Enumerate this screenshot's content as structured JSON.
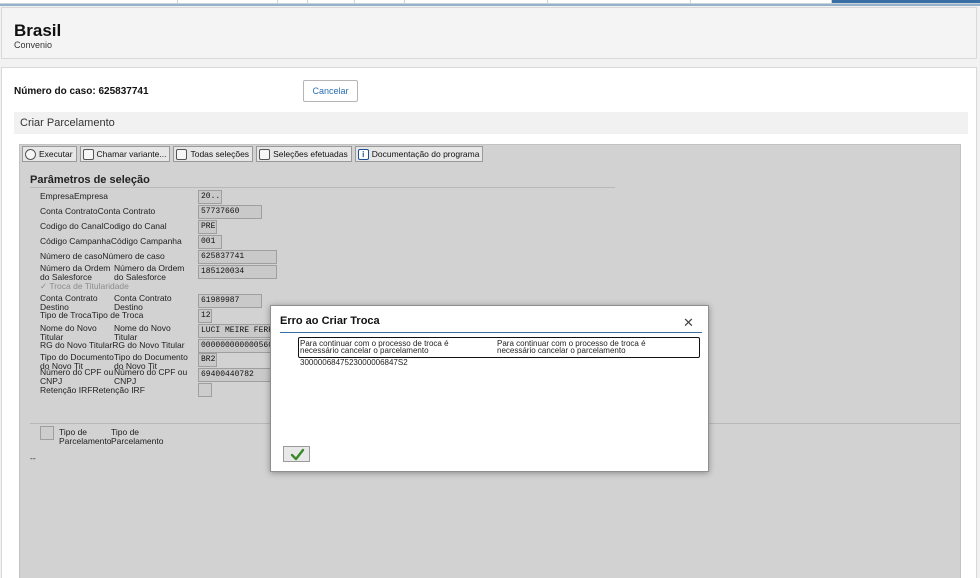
{
  "header": {
    "title": "Brasil",
    "subtitle": "Convenio"
  },
  "case": {
    "label": "Número do caso: 625837741",
    "cancel_label": "Cancelar"
  },
  "section_title": "Criar Parcelamento",
  "toolbar": [
    {
      "label": "Executar",
      "icon": "clock-icon"
    },
    {
      "label": "Chamar variante...",
      "icon": "variant-icon"
    },
    {
      "label": "Todas seleções",
      "icon": "selection-icon"
    },
    {
      "label": "Seleções efetuadas",
      "icon": "list-icon"
    },
    {
      "label": "Documentação do programa",
      "icon": "info-icon"
    }
  ],
  "params": {
    "title": "Parâmetros de seleção",
    "empresa": {
      "label": "EmpresaEmpresa",
      "value": "20.."
    },
    "conta_contrato": {
      "label": "Conta ContratoConta Contrato",
      "value": "57737660"
    },
    "codigo_canal": {
      "label": "Codigo do CanalCodigo do Canal",
      "value": "PRE"
    },
    "codigo_campanha": {
      "label": "Código CampanhaCódigo Campanha",
      "value": "001"
    },
    "numero_caso": {
      "label": "Número de casoNúmero de caso",
      "value": "625837741"
    },
    "ordem_sf": {
      "label_a": "Número da Ordem do Salesforce",
      "label_b": "Número da Ordem do Salesforce",
      "value": "185120034"
    },
    "troca_titularidade": {
      "label": "Troca de Titularidade"
    },
    "conta_destino": {
      "label_a": "Conta Contrato Destino",
      "label_b": "Conta Contrato Destino",
      "value": "61989987"
    },
    "tipo_troca": {
      "label": "Tipo de TrocaTipo de Troca",
      "value": "12"
    },
    "nome_titular": {
      "label_a": "Nome do Novo Titular",
      "label_b": "Nome do Novo Titular",
      "value": "LUCI MEIRE FERR"
    },
    "rg_titular": {
      "label": "RG do Novo TitularRG do Novo Titular",
      "value": "000000000000560"
    },
    "tipo_documento": {
      "label_a": "Tipo do Documento do Novo Tit",
      "label_b": "Tipo do Documento do Novo Tit",
      "value": "BR2"
    },
    "cpf_cnpj": {
      "label_a": "Número do CPF ou CNPJ",
      "label_b": "Número do CPF ou CNPJ",
      "value": "69400440782"
    },
    "retencao": {
      "label": "Retenção IRFRetenção IRF"
    },
    "tipo_parcelamento": {
      "label_a": "Tipo de Parcelamento",
      "label_b": "Tipo de Parcelamento"
    },
    "footer_dash": "--"
  },
  "modal": {
    "title": "Erro ao Criar Troca",
    "message_col1": "Para continuar com o processo de troca é necessário cancelar o parcelamento",
    "message_col2": "Para continuar com o processo de troca é necessário cancelar o parcelamento",
    "number_line": "3000006847523000006847S2"
  },
  "colors": {
    "accent": "#3a6fa6",
    "link": "#2a6fb5",
    "frame_bg": "#d2d2d2"
  }
}
